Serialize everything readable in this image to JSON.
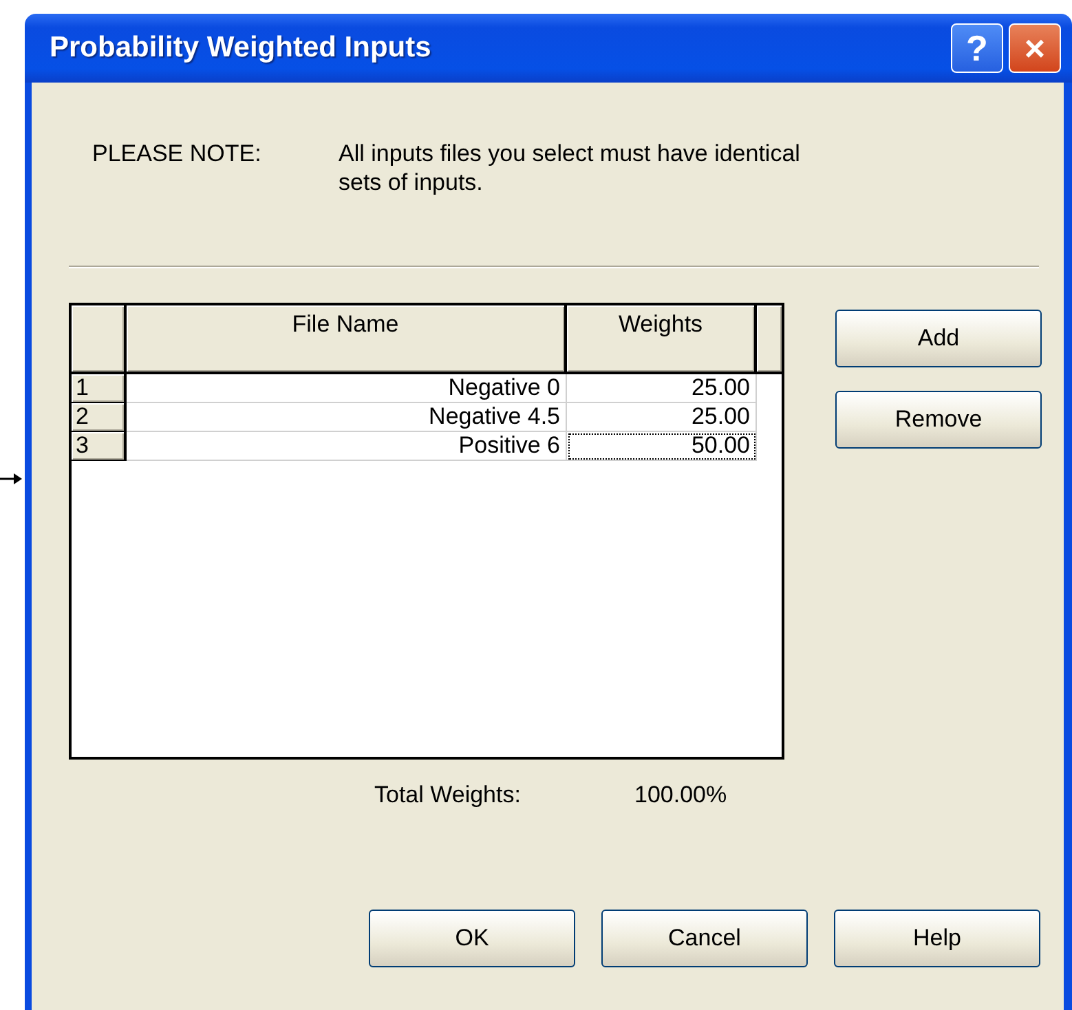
{
  "window": {
    "title": "Probability Weighted Inputs",
    "title_buttons": [
      "?",
      "×"
    ]
  },
  "note": {
    "label": "PLEASE NOTE:",
    "text": "All inputs files you select must have identical sets of inputs."
  },
  "table": {
    "columns": [
      "File Name",
      "Weights"
    ],
    "rows": [
      {
        "number": "1",
        "file_name": "Negative 0",
        "weight": "25.00",
        "focused": false
      },
      {
        "number": "2",
        "file_name": "Negative 4.5",
        "weight": "25.00",
        "focused": false
      },
      {
        "number": "3",
        "file_name": "Positive 6",
        "weight": "50.00",
        "focused": true
      }
    ]
  },
  "side_buttons": [
    "Add",
    "Remove"
  ],
  "total": {
    "label": "Total Weights:",
    "value": "100.00%"
  },
  "buttons": [
    "OK",
    "Cancel",
    "Help"
  ]
}
